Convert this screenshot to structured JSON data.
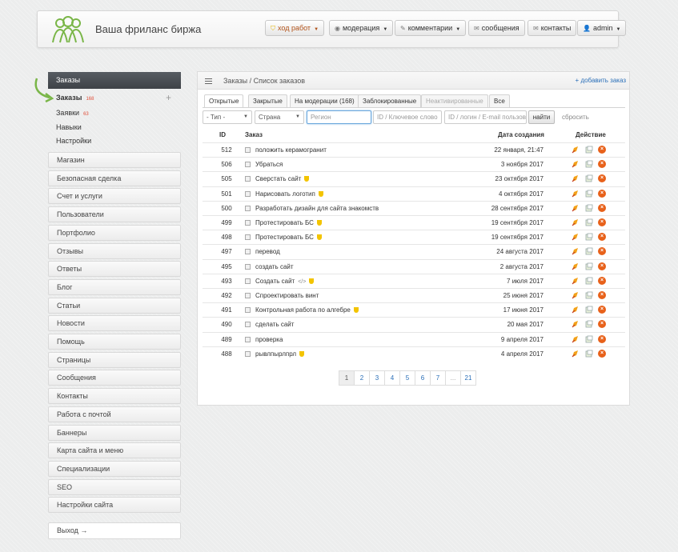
{
  "header": {
    "brand": "Ваша фриланс биржа",
    "buttons": [
      {
        "label": "ход работ",
        "icon": "shield-icon",
        "caret": true
      },
      {
        "label": "модерация",
        "icon": "eye-icon",
        "caret": true
      },
      {
        "label": "комментарии",
        "icon": "pencil-icon",
        "caret": true
      },
      {
        "label": "сообщения",
        "icon": "envelope-icon",
        "caret": false
      },
      {
        "label": "контакты",
        "icon": "envelope-icon",
        "caret": false
      },
      {
        "label": "admin",
        "icon": "user-icon",
        "caret": true
      }
    ]
  },
  "sidebar": {
    "head": "Заказы",
    "sub": [
      {
        "label": "Заказы",
        "count": "168",
        "active": true
      },
      {
        "label": "Заявки",
        "count": "63",
        "active": false
      },
      {
        "label": "Навыки",
        "count": "",
        "active": false
      },
      {
        "label": "Настройки",
        "count": "",
        "active": false
      }
    ],
    "items": [
      "Магазин",
      "Безопасная сделка",
      "Счет и услуги",
      "Пользователи",
      "Портфолио",
      "Отзывы",
      "Ответы",
      "Блог",
      "Статьи",
      "Новости",
      "Помощь",
      "Страницы",
      "Сообщения",
      "Контакты",
      "Работа с почтой",
      "Баннеры",
      "Карта сайта и меню",
      "Специализации",
      "SEO",
      "Настройки сайта"
    ],
    "logout": "Выход →"
  },
  "panel": {
    "breadcrumb": "Заказы / Список заказов",
    "add_link": "+ добавить заказ",
    "tabs": [
      "Открытые",
      "Закрытые",
      "На модерации (168)",
      "Заблокированные",
      "Неактивированные",
      "Все"
    ],
    "filters": {
      "type": "- Тип -",
      "country": "Страна",
      "region_placeholder": "Регион",
      "keyword_placeholder": "ID / Ключевое слово",
      "user_placeholder": "ID / логин / E-mail пользов",
      "find": "найти",
      "reset": "сбросить"
    },
    "columns": {
      "id": "ID",
      "order": "Заказ",
      "date": "Дата создания",
      "action": "Действие"
    },
    "rows": [
      {
        "id": "512",
        "title": "положить керамогранит",
        "shield": false,
        "code": false,
        "date": "22 января, 21:47"
      },
      {
        "id": "506",
        "title": "Убраться",
        "shield": false,
        "code": false,
        "date": "3 ноября 2017"
      },
      {
        "id": "505",
        "title": "Сверстать сайт",
        "shield": true,
        "code": false,
        "date": "23 октября 2017"
      },
      {
        "id": "501",
        "title": "Нарисовать логотип",
        "shield": true,
        "code": false,
        "date": "4 октября 2017"
      },
      {
        "id": "500",
        "title": "Разработать дизайн для сайта знакомств",
        "shield": false,
        "code": false,
        "date": "28 сентября 2017"
      },
      {
        "id": "499",
        "title": "Протестировать БС",
        "shield": true,
        "code": false,
        "date": "19 сентября 2017"
      },
      {
        "id": "498",
        "title": "Протестировать БС",
        "shield": true,
        "code": false,
        "date": "19 сентября 2017"
      },
      {
        "id": "497",
        "title": "перевод",
        "shield": false,
        "code": false,
        "date": "24 августа 2017"
      },
      {
        "id": "495",
        "title": "создать сайт",
        "shield": false,
        "code": false,
        "date": "2 августа 2017"
      },
      {
        "id": "493",
        "title": "Создать сайт",
        "shield": true,
        "code": true,
        "date": "7 июля 2017"
      },
      {
        "id": "492",
        "title": "Спроектировать винт",
        "shield": false,
        "code": false,
        "date": "25 июня 2017"
      },
      {
        "id": "491",
        "title": "Контрольная работа по алгебре",
        "shield": true,
        "code": false,
        "date": "17 июня 2017"
      },
      {
        "id": "490",
        "title": "сделать сайт",
        "shield": false,
        "code": false,
        "date": "20 мая 2017"
      },
      {
        "id": "489",
        "title": "проверка",
        "shield": false,
        "code": false,
        "date": "9 апреля 2017"
      },
      {
        "id": "488",
        "title": "рывлпырлпрл",
        "shield": true,
        "code": false,
        "date": "4 апреля 2017"
      }
    ],
    "pager": [
      "1",
      "2",
      "3",
      "4",
      "5",
      "6",
      "7",
      "...",
      "21"
    ],
    "current_page": "1"
  }
}
